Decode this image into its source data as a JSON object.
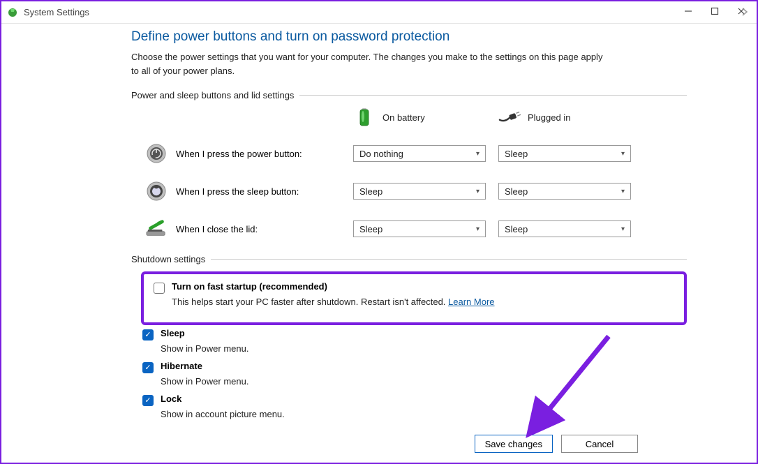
{
  "window": {
    "title": "System Settings"
  },
  "page": {
    "title": "Define power buttons and turn on password protection",
    "description": "Choose the power settings that you want for your computer. The changes you make to the settings on this page apply to all of your power plans."
  },
  "sections": {
    "buttons_lid": "Power and sleep buttons and lid settings",
    "shutdown": "Shutdown settings"
  },
  "columns": {
    "battery": "On battery",
    "plugged": "Plugged in"
  },
  "rows": {
    "power_button": {
      "label": "When I press the power button:",
      "battery": "Do nothing",
      "plugged": "Sleep"
    },
    "sleep_button": {
      "label": "When I press the sleep button:",
      "battery": "Sleep",
      "plugged": "Sleep"
    },
    "lid": {
      "label": "When I close the lid:",
      "battery": "Sleep",
      "plugged": "Sleep"
    }
  },
  "shutdown": {
    "fast_startup": {
      "title": "Turn on fast startup (recommended)",
      "desc": "This helps start your PC faster after shutdown. Restart isn't affected. ",
      "learn_more": "Learn More"
    },
    "sleep": {
      "title": "Sleep",
      "desc": "Show in Power menu."
    },
    "hibernate": {
      "title": "Hibernate",
      "desc": "Show in Power menu."
    },
    "lock": {
      "title": "Lock",
      "desc": "Show in account picture menu."
    }
  },
  "buttons": {
    "save": "Save changes",
    "cancel": "Cancel"
  }
}
